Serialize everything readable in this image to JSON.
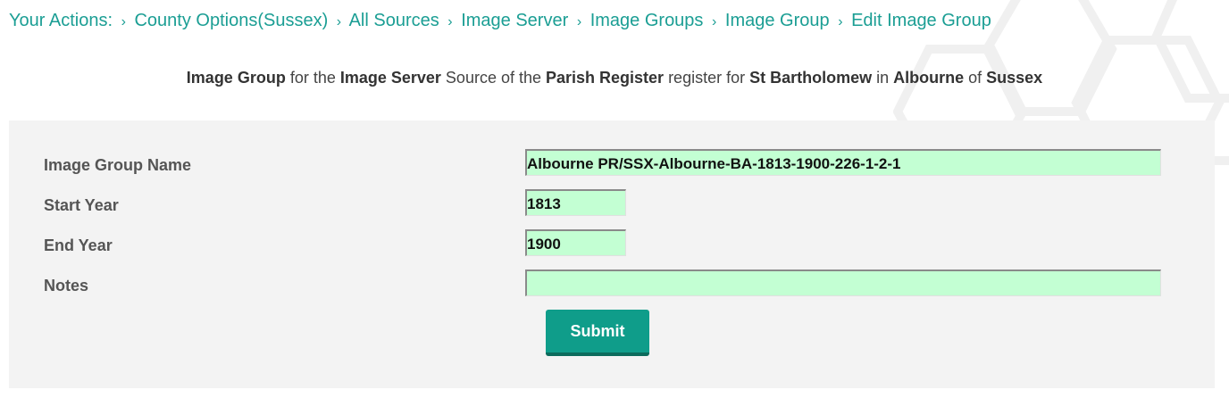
{
  "breadcrumb": {
    "prefix": "Your Actions:",
    "items": [
      "County Options(Sussex)",
      "All Sources",
      "Image Server",
      "Image Groups",
      "Image Group",
      "Edit Image Group"
    ]
  },
  "subtitle": {
    "p1": "Image Group",
    "t1": " for the ",
    "p2": "Image Server",
    "t2": " Source of the ",
    "p3": "Parish Register",
    "t3": " register for ",
    "p4": "St Bartholomew",
    "t4": " in ",
    "p5": "Albourne",
    "t5": " of ",
    "p6": "Sussex"
  },
  "form": {
    "name_label": "Image Group Name",
    "name_value": "Albourne PR/SSX-Albourne-BA-1813-1900-226-1-2-1",
    "start_label": "Start Year",
    "start_value": "1813",
    "end_label": "End Year",
    "end_value": "1900",
    "notes_label": "Notes",
    "notes_value": "",
    "submit_label": "Submit"
  },
  "colors": {
    "accent": "#1b9e94",
    "button": "#0f9d8a",
    "field_bg": "#c3ffd3",
    "panel_bg": "#f3f3f3"
  }
}
